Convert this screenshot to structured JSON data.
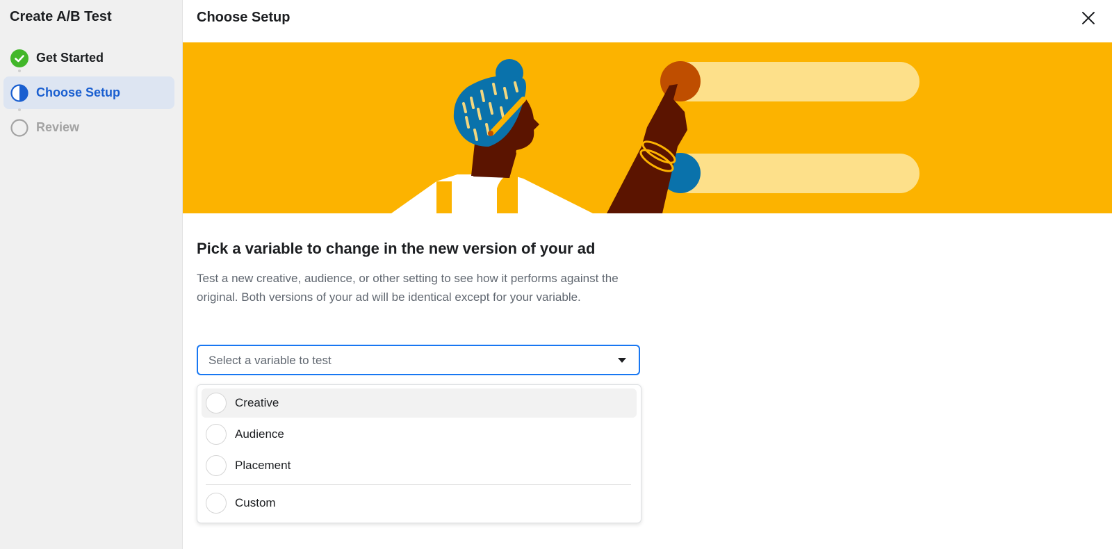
{
  "sidebar": {
    "title": "Create A/B Test",
    "steps": [
      {
        "label": "Get Started",
        "state": "completed",
        "icon": "check-circle-icon"
      },
      {
        "label": "Choose Setup",
        "state": "active",
        "icon": "half-circle-icon"
      },
      {
        "label": "Review",
        "state": "pending",
        "icon": "empty-circle-icon"
      }
    ]
  },
  "header": {
    "title": "Choose Setup",
    "close_icon": "close-icon"
  },
  "banner": {
    "illustration": "person pressing toggle buttons",
    "colors": {
      "background": "#fcb300",
      "pill": "#fde08a",
      "button_top": "#bf4e00",
      "button_bottom": "#0a72ab"
    }
  },
  "content": {
    "heading": "Pick a variable to change in the new version of your ad",
    "description": "Test a new creative, audience, or other setting to see how it performs against the original. Both versions of your ad will be identical except for your variable.",
    "select": {
      "placeholder": "Select a variable to test",
      "caret_icon": "caret-down-icon",
      "options": [
        {
          "label": "Creative",
          "hovered": true
        },
        {
          "label": "Audience",
          "hovered": false
        },
        {
          "label": "Placement",
          "hovered": false
        },
        {
          "label": "Custom",
          "hovered": false
        }
      ]
    }
  },
  "colors": {
    "accent": "#1877f2",
    "active_step_text": "#1a5fd0",
    "active_step_bg": "#dde5f2",
    "success": "#42b72a"
  }
}
